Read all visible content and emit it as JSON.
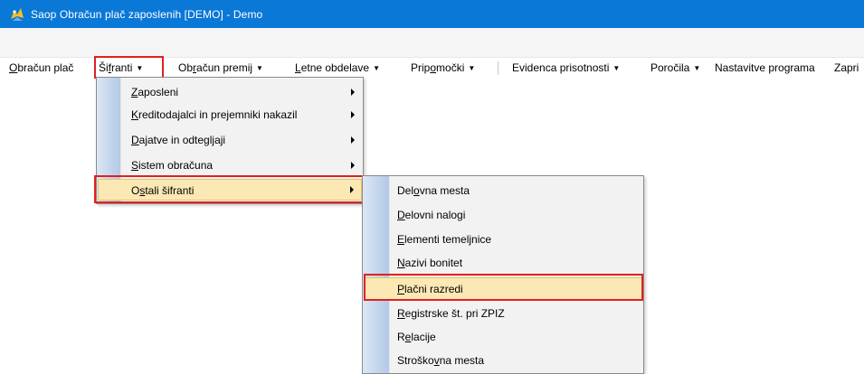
{
  "window": {
    "title": "Saop Obračun plač zaposlenih  [DEMO] - Demo",
    "icon": "saop-app-icon"
  },
  "menubar": {
    "items": [
      {
        "id": "obracun-plac",
        "label_ul": "O",
        "label_rest": "bračun plač"
      },
      {
        "id": "sifranti",
        "label_pre": "Ši",
        "label_ul": "f",
        "label_rest": "ranti",
        "arrow": "▼"
      },
      {
        "id": "obracun-premij",
        "label_pre": "Ob",
        "label_ul": "r",
        "label_rest": "ačun premij",
        "arrow": "▼"
      },
      {
        "id": "letne-obdelave",
        "label_ul": "L",
        "label_rest": "etne obdelave",
        "arrow": "▼"
      },
      {
        "id": "pripomocki",
        "label_pre": "Prip",
        "label_ul": "o",
        "label_rest": "močki",
        "arrow": "▼"
      },
      {
        "id": "evidenca-prisotnosti",
        "label": "Evidenca prisotnosti",
        "arrow": "▼"
      },
      {
        "id": "porocila",
        "label": "Poročila",
        "arrow": "▼"
      },
      {
        "id": "nastavitve-programa",
        "label": "Nastavitve programa"
      },
      {
        "id": "zapri",
        "label": "Zapri"
      }
    ]
  },
  "sifranti_menu": {
    "items": [
      {
        "label_ul": "Z",
        "label_rest": "aposleni",
        "has_submenu": true
      },
      {
        "label_ul": "K",
        "label_rest": "reditodajalci in prejemniki nakazil",
        "has_submenu": true
      },
      {
        "label_ul": "D",
        "label_rest": "ajatve in odtegljaji",
        "has_submenu": true
      },
      {
        "label_ul": "S",
        "label_rest": "istem obračuna",
        "has_submenu": true
      },
      {
        "label_pre": "O",
        "label_ul": "s",
        "label_rest": "tali šifranti",
        "has_submenu": true,
        "selected": true
      }
    ]
  },
  "ostali_menu": {
    "items": [
      {
        "label_pre": "Del",
        "label_ul": "o",
        "label_rest": "vna mesta"
      },
      {
        "label_ul": "D",
        "label_rest": "elovni nalogi"
      },
      {
        "label_ul": "E",
        "label_rest": "lementi temeljnice"
      },
      {
        "label_ul": "N",
        "label_rest": "azivi bonitet"
      },
      {
        "label_ul": "P",
        "label_rest": "lačni razredi",
        "selected": true
      },
      {
        "label_ul": "R",
        "label_rest": "egistrske št. pri ZPIZ"
      },
      {
        "label_pre": "R",
        "label_ul": "e",
        "label_rest": "lacije"
      },
      {
        "label_pre": "Stroško",
        "label_ul": "v",
        "label_rest": "na mesta"
      }
    ]
  },
  "colors": {
    "titlebar": "#0a78d7",
    "highlight_border": "#e02020",
    "selected_bg": "#fbe8b4"
  }
}
